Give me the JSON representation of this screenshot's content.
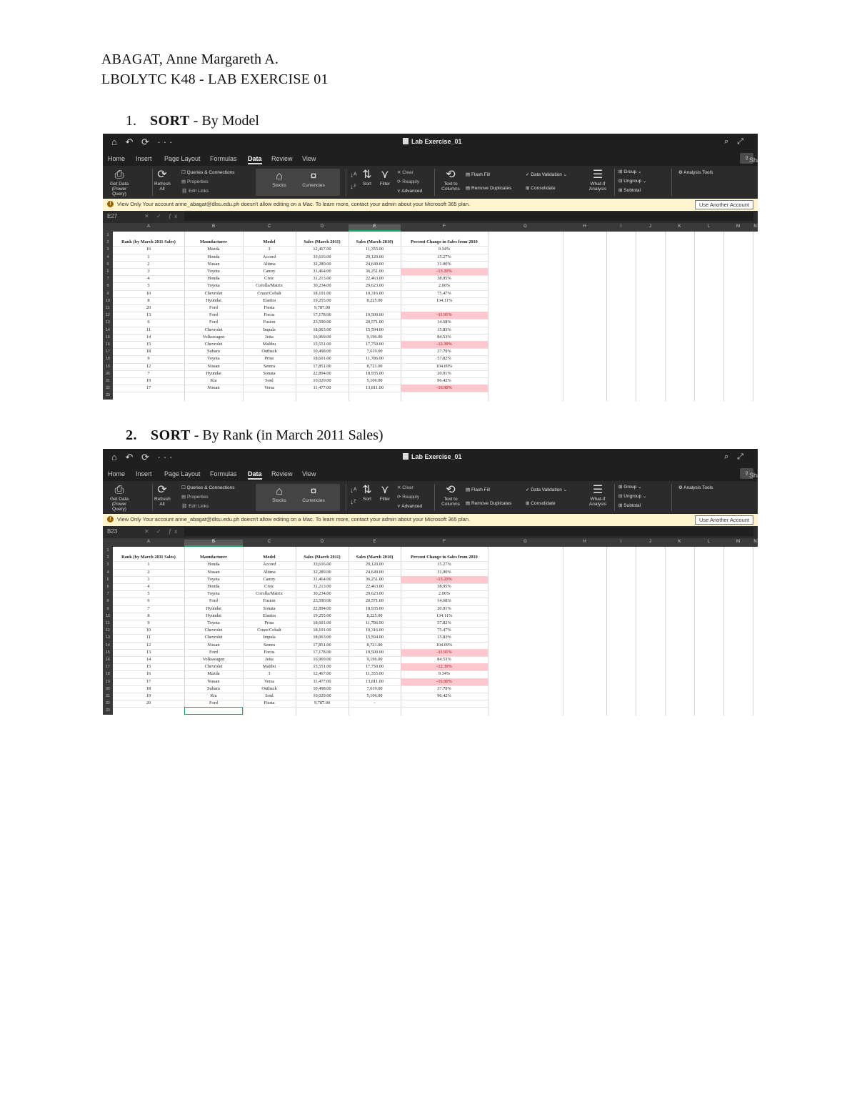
{
  "header": {
    "name": "ABAGAT, Anne Margareth A.",
    "course": "LBOLYTC K48 - LAB EXERCISE 01"
  },
  "sections": [
    {
      "num": "1.",
      "title": "SORT",
      "rest": " - By Model"
    },
    {
      "num": "2.",
      "title": "SORT",
      "rest": " - By Rank (in March 2011 Sales)"
    }
  ],
  "excel": {
    "file_name": "Lab Exercise_01",
    "tabs": [
      "Home",
      "Insert",
      "Page Layout",
      "Formulas",
      "Data",
      "Review",
      "View"
    ],
    "active_tab": "Data",
    "share_label": "Share",
    "ribbon": {
      "get_data": "Get Data (Power Query)",
      "refresh": "Refresh All",
      "queries": "Queries & Connections",
      "properties": "Properties",
      "edit_links": "Edit Links",
      "stocks": "Stocks",
      "currencies": "Currencies",
      "sort": "Sort",
      "filter": "Filter",
      "clear": "Clear",
      "reapply": "Reapply",
      "advanced": "Advanced",
      "text_to_columns": "Text to Columns",
      "flash_fill": "Flash Fill",
      "remove_duplicates": "Remove Duplicates",
      "data_validation": "Data Validation",
      "consolidate": "Consolidate",
      "what_if": "What-If Analysis",
      "group": "Group",
      "ungroup": "Ungroup",
      "subtotal": "Subtotal",
      "analysis_tools": "Analysis Tools"
    },
    "message": "View Only  Your account anne_abagat@dlsu.edu.ph doesn't allow editing on a Mac. To learn more, contact your admin about your Microsoft 365 plan.",
    "message_button": "Use Another Account",
    "columns": [
      "A",
      "B",
      "C",
      "D",
      "E",
      "F",
      "G",
      "H",
      "I",
      "J",
      "K",
      "L",
      "M",
      "N"
    ],
    "headers": [
      "Rank (by March 2011 Sales)",
      "Manufacturer",
      "Model",
      "Sales (March 2011)",
      "Sales (March 2010)",
      "Percent Change in Sales from 2010"
    ]
  },
  "table1": {
    "name_box": "E27",
    "rows": [
      [
        "16",
        "Mazda",
        "3",
        "12,467.00",
        "11,355.00",
        "9.34%",
        false
      ],
      [
        "1",
        "Honda",
        "Accord",
        "33,616.00",
        "29,120.00",
        "15.27%",
        false
      ],
      [
        "2",
        "Nissan",
        "Altima",
        "32,289.00",
        "24,649.00",
        "31.00%",
        false
      ],
      [
        "3",
        "Toyota",
        "Camry",
        "31,464.00",
        "36,251.00",
        "-13.20%",
        true
      ],
      [
        "4",
        "Honda",
        "Civic",
        "31,213.00",
        "22,463.00",
        "38.95%",
        false
      ],
      [
        "5",
        "Toyota",
        "Corolla/Matrix",
        "30,234.00",
        "29,623.00",
        "2.06%",
        false
      ],
      [
        "10",
        "Chevrolet",
        "Cruze/Cobalt",
        "18,101.00",
        "10,316.00",
        "75.47%",
        false
      ],
      [
        "8",
        "Hyundai",
        "Elantra",
        "19,255.00",
        "8,225.00",
        "134.11%",
        false
      ],
      [
        "20",
        "Ford",
        "Fiesta",
        "9,787.00",
        "",
        "",
        false
      ],
      [
        "13",
        "Ford",
        "Focus",
        "17,178.00",
        "19,500.00",
        "-11.91%",
        true
      ],
      [
        "6",
        "Ford",
        "Fusion",
        "23,590.00",
        "20,571.00",
        "14.68%",
        false
      ],
      [
        "11",
        "Chevrolet",
        "Impala",
        "18,063.00",
        "15,594.00",
        "15.83%",
        false
      ],
      [
        "14",
        "Volkswagen",
        "Jetta",
        "16,969.00",
        "9,196.00",
        "84.53%",
        false
      ],
      [
        "15",
        "Chevrolet",
        "Malibu",
        "15,551.00",
        "17,750.00",
        "-12.39%",
        true
      ],
      [
        "18",
        "Subaru",
        "Outback",
        "10,498.00",
        "7,619.00",
        "37.79%",
        false
      ],
      [
        "9",
        "Toyota",
        "Prius",
        "18,601.00",
        "11,786.00",
        "57.82%",
        false
      ],
      [
        "12",
        "Nissan",
        "Sentra",
        "17,851.00",
        "8,721.00",
        "104.69%",
        false
      ],
      [
        "7",
        "Hyundai",
        "Sonata",
        "22,894.00",
        "18,935.00",
        "20.91%",
        false
      ],
      [
        "19",
        "Kia",
        "Soul",
        "10,029.00",
        "5,106.00",
        "96.42%",
        false
      ],
      [
        "17",
        "Nissan",
        "Versa",
        "11,477.00",
        "13,811.00",
        "-16.90%",
        true
      ]
    ]
  },
  "table2": {
    "name_box": "B23",
    "rows": [
      [
        "1",
        "Honda",
        "Accord",
        "33,616.00",
        "29,120.00",
        "15.27%",
        false
      ],
      [
        "2",
        "Nissan",
        "Altima",
        "32,289.00",
        "24,649.00",
        "31.00%",
        false
      ],
      [
        "3",
        "Toyota",
        "Camry",
        "31,464.00",
        "36,251.00",
        "-13.20%",
        true
      ],
      [
        "4",
        "Honda",
        "Civic",
        "31,213.00",
        "22,463.00",
        "38.95%",
        false
      ],
      [
        "5",
        "Toyota",
        "Corolla/Matrix",
        "30,234.00",
        "29,623.00",
        "2.06%",
        false
      ],
      [
        "6",
        "Ford",
        "Fusion",
        "23,590.00",
        "20,571.00",
        "14.68%",
        false
      ],
      [
        "7",
        "Hyundai",
        "Sonata",
        "22,894.00",
        "18,935.00",
        "20.91%",
        false
      ],
      [
        "8",
        "Hyundai",
        "Elantra",
        "19,255.00",
        "8,225.00",
        "134.11%",
        false
      ],
      [
        "9",
        "Toyota",
        "Prius",
        "18,601.00",
        "11,786.00",
        "57.82%",
        false
      ],
      [
        "10",
        "Chevrolet",
        "Cruze/Cobalt",
        "18,101.00",
        "10,316.00",
        "75.47%",
        false
      ],
      [
        "11",
        "Chevrolet",
        "Impala",
        "18,063.00",
        "15,594.00",
        "15.83%",
        false
      ],
      [
        "12",
        "Nissan",
        "Sentra",
        "17,851.00",
        "8,721.00",
        "104.69%",
        false
      ],
      [
        "13",
        "Ford",
        "Focus",
        "17,178.00",
        "19,500.00",
        "-11.91%",
        true
      ],
      [
        "14",
        "Volkswagen",
        "Jetta",
        "16,969.00",
        "9,196.00",
        "84.53%",
        false
      ],
      [
        "15",
        "Chevrolet",
        "Malibu",
        "15,551.00",
        "17,750.00",
        "-12.39%",
        true
      ],
      [
        "16",
        "Mazda",
        "3",
        "12,467.00",
        "11,355.00",
        "9.34%",
        false
      ],
      [
        "17",
        "Nissan",
        "Versa",
        "11,477.00",
        "13,811.00",
        "-16.90%",
        true
      ],
      [
        "18",
        "Subaru",
        "Outback",
        "10,498.00",
        "7,619.00",
        "37.79%",
        false
      ],
      [
        "19",
        "Kia",
        "Soul",
        "10,029.00",
        "5,106.00",
        "96.42%",
        false
      ],
      [
        "20",
        "Ford",
        "Fiesta",
        "9,787.00",
        "-",
        "",
        false
      ]
    ]
  },
  "colors": {
    "negative_fill": "#ffc7ce",
    "negative_text": "#9c0006",
    "selection": "#21a366",
    "dark_bg": "#1f1f1f",
    "message_bg": "#fff4ce"
  }
}
